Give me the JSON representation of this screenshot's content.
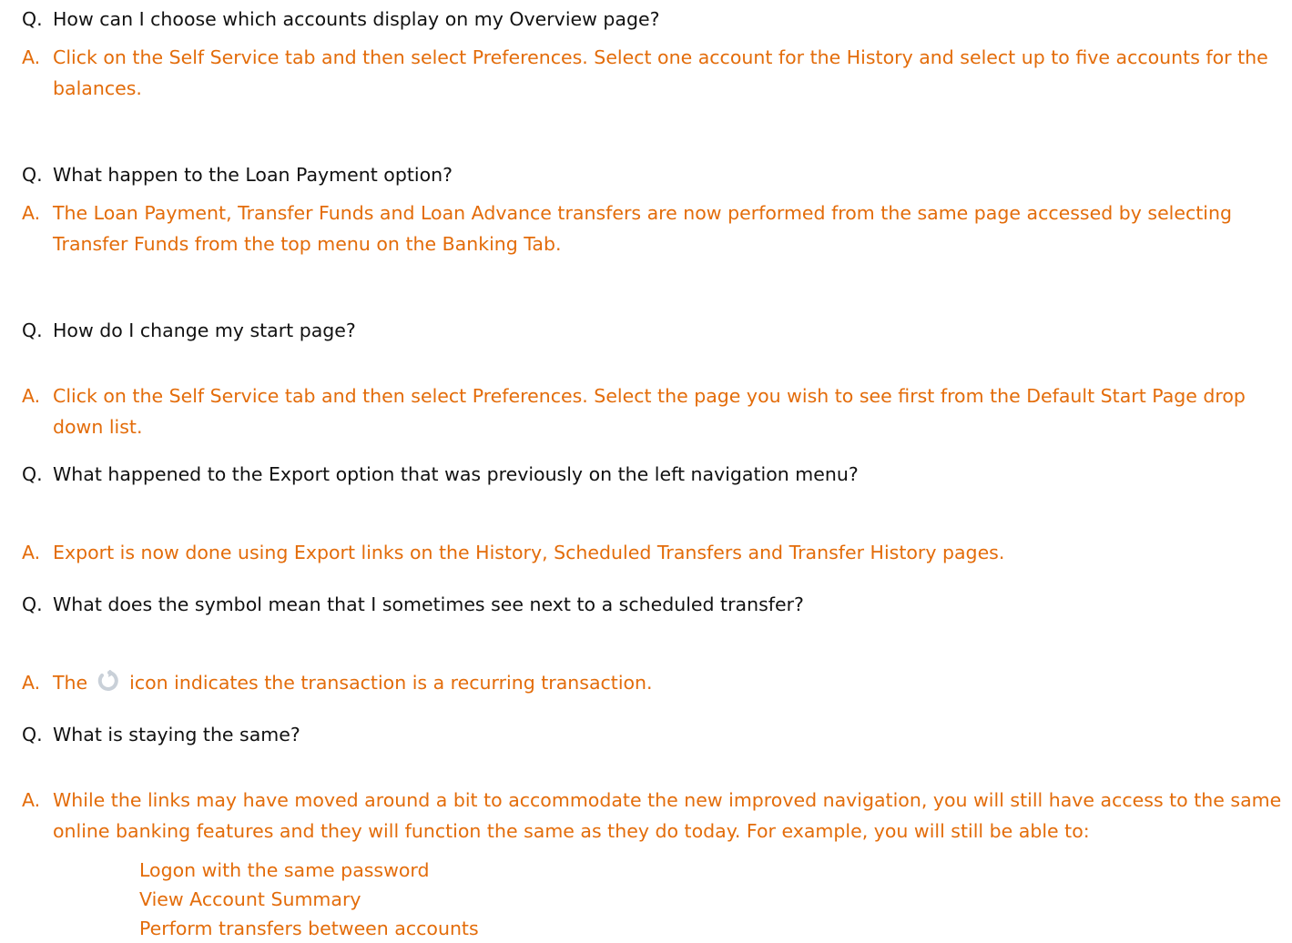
{
  "faq": {
    "q_prefix": "Q.",
    "a_prefix": "A.",
    "items": [
      {
        "question": "How can I choose which accounts display on my Overview page?",
        "answer": "Click on the Self Service tab and then select Preferences. Select one account for the History and select up to five accounts for the balances."
      },
      {
        "question": "What happen to the Loan Payment option?",
        "answer": "The Loan Payment, Transfer Funds and Loan Advance transfers are now performed from the same page accessed by selecting Transfer Funds from the top menu on the Banking Tab."
      },
      {
        "question": "How do I change my start page?",
        "answer": "Click on the Self Service tab and then select Preferences.  Select the page you wish to see first from the Default Start Page drop down list."
      },
      {
        "question": "What happened to the Export option that was previously on the left navigation menu?",
        "answer": "Export is now done using Export links on the History, Scheduled Transfers and Transfer History pages."
      },
      {
        "question": "What does the symbol mean that I sometimes see next to a scheduled transfer?",
        "answer_before_icon": "The",
        "answer_after_icon": "icon indicates the transaction is a recurring transaction.",
        "icon": "recurring-icon"
      },
      {
        "question": "What is staying the same?",
        "answer": "While the links may have moved around a bit to accommodate the new improved navigation, you will still have access to the same online banking features and they will function the same as they do today. For example, you will still be able to:",
        "list": [
          "Logon with the same password",
          "View Account Summary",
          "Perform transfers between accounts"
        ]
      }
    ]
  },
  "colors": {
    "question": "#111111",
    "answer": "#e36c0a",
    "icon": "#c9d0d8"
  }
}
